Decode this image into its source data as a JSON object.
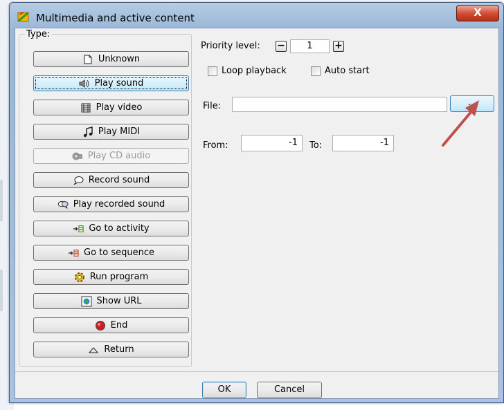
{
  "window": {
    "title": "Multimedia and active content",
    "close_label": "X"
  },
  "type_group": {
    "legend": "Type:",
    "buttons": [
      {
        "label": "Unknown",
        "icon": "document-icon"
      },
      {
        "label": "Play sound",
        "icon": "speaker-icon"
      },
      {
        "label": "Play video",
        "icon": "film-icon"
      },
      {
        "label": "Play MIDI",
        "icon": "music-note-icon"
      },
      {
        "label": "Play CD audio",
        "icon": "cd-icon"
      },
      {
        "label": "Record sound",
        "icon": "speech-bubble-icon"
      },
      {
        "label": "Play recorded sound",
        "icon": "speech-bubbles-icon"
      },
      {
        "label": "Go to activity",
        "icon": "arrow-list-icon"
      },
      {
        "label": "Go to sequence",
        "icon": "arrow-list-red-icon"
      },
      {
        "label": "Run program",
        "icon": "gear-icon"
      },
      {
        "label": "Show URL",
        "icon": "globe-icon"
      },
      {
        "label": "End",
        "icon": "stop-icon"
      },
      {
        "label": "Return",
        "icon": "triangle-up-icon"
      }
    ],
    "selected": "Play sound",
    "disabled": [
      "Play CD audio"
    ]
  },
  "priority": {
    "label": "Priority level:",
    "value": "1",
    "minus": "−",
    "plus": "+"
  },
  "loop_playback": {
    "label": "Loop playback",
    "checked": false
  },
  "auto_start": {
    "label": "Auto start",
    "checked": false
  },
  "file": {
    "label": "File:",
    "value": "",
    "browse_label": "..."
  },
  "range": {
    "from_label": "From:",
    "from_value": "-1",
    "to_label": "To:",
    "to_value": "-1"
  },
  "footer": {
    "ok_label": "OK",
    "cancel_label": "Cancel"
  },
  "colors": {
    "annotation_arrow": "#c0504d",
    "title_bar": "#a9c2df",
    "close_button": "#d04a30"
  }
}
